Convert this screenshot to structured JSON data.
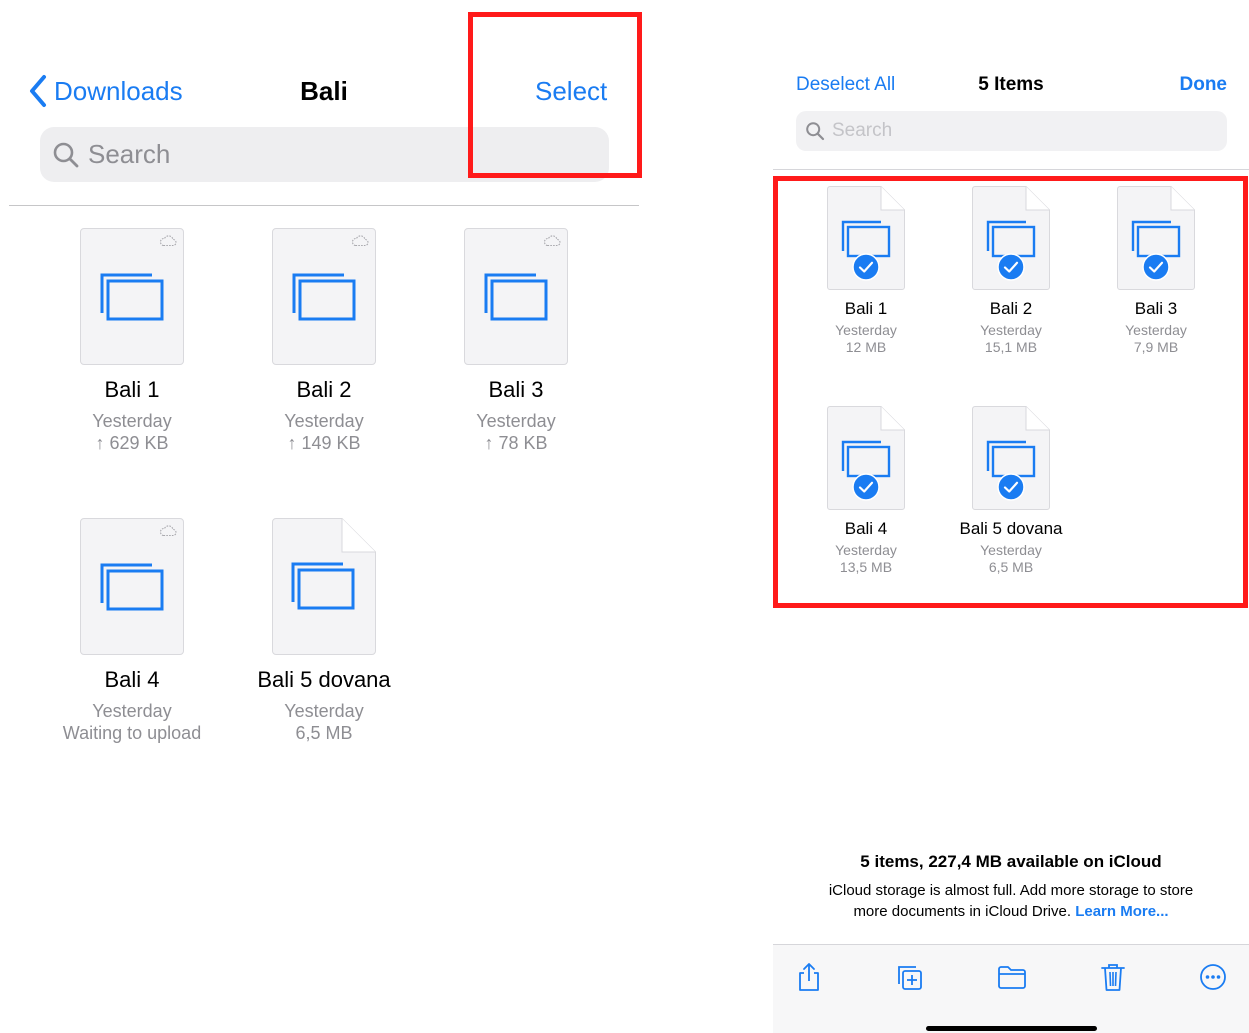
{
  "left": {
    "nav": {
      "back_label": "Downloads",
      "title": "Bali",
      "select_label": "Select"
    },
    "search": {
      "placeholder": "Search"
    },
    "files": [
      {
        "name": "Bali 1",
        "date": "Yesterday",
        "status": "↑ 629 KB",
        "icon": "cloud-icon"
      },
      {
        "name": "Bali 2",
        "date": "Yesterday",
        "status": "↑ 149 KB",
        "icon": "cloud-icon"
      },
      {
        "name": "Bali 3",
        "date": "Yesterday",
        "status": "↑ 78 KB",
        "icon": "cloud-icon"
      },
      {
        "name": "Bali 4",
        "date": "Yesterday",
        "status": "Waiting to upload",
        "icon": "cloud-icon"
      },
      {
        "name": "Bali 5 dovana",
        "date": "Yesterday",
        "status": "6,5 MB",
        "icon": "none"
      }
    ]
  },
  "right": {
    "nav": {
      "deselect_label": "Deselect All",
      "title": "5 Items",
      "done_label": "Done"
    },
    "search": {
      "placeholder": "Search"
    },
    "files": [
      {
        "name": "Bali 1",
        "date": "Yesterday",
        "size": "12 MB",
        "selected": true
      },
      {
        "name": "Bali 2",
        "date": "Yesterday",
        "size": "15,1 MB",
        "selected": true
      },
      {
        "name": "Bali 3",
        "date": "Yesterday",
        "size": "7,9 MB",
        "selected": true
      },
      {
        "name": "Bali 4",
        "date": "Yesterday",
        "size": "13,5 MB",
        "selected": true
      },
      {
        "name": "Bali 5 dovana",
        "date": "Yesterday",
        "size": "6,5 MB",
        "selected": true
      }
    ],
    "info": {
      "title": "5 items, 227,4 MB available on iCloud",
      "text": "iCloud storage is almost full. Add more storage to store more documents in iCloud Drive.",
      "link": "Learn More..."
    },
    "toolbar": [
      "share-icon",
      "duplicate-icon",
      "move-folder-icon",
      "trash-icon",
      "more-icon"
    ]
  },
  "colors": {
    "accent": "#1a7cf2",
    "highlight": "#ff1a1a",
    "secondary_text": "#8e8e93"
  }
}
